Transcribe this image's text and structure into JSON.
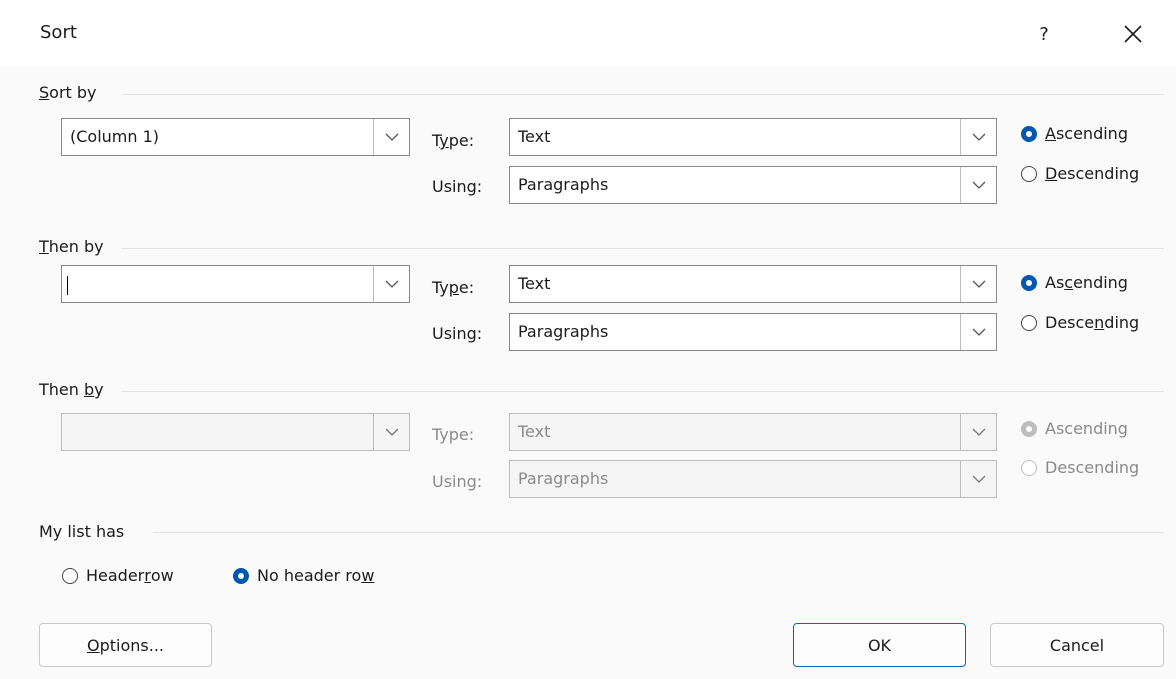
{
  "title": "Sort",
  "help_label": "?",
  "sort_by": {
    "label_u": "S",
    "label_rest": "ort by",
    "column_value": "(Column 1)",
    "type_label_a": "T",
    "type_label_u": "y",
    "type_label_b": "pe:",
    "type_value": "Text",
    "using_label": "Using:",
    "using_value": "Paragraphs",
    "asc_u": "A",
    "asc_rest": "scending",
    "desc_u": "D",
    "desc_rest": "escending"
  },
  "then_by_1": {
    "label_u": "T",
    "label_rest": "hen by",
    "column_value": "",
    "type_label_a": "Ty",
    "type_label_u": "p",
    "type_label_b": "e:",
    "type_value": "Text",
    "using_label": "Using:",
    "using_value": "Paragraphs",
    "asc_a": "As",
    "asc_u": "c",
    "asc_b": "ending",
    "desc_a": "Desce",
    "desc_u": "n",
    "desc_b": "ding"
  },
  "then_by_2": {
    "label_a": "Then ",
    "label_u": "b",
    "label_b": "y",
    "column_value": "",
    "type_label": "Type:",
    "type_value": "Text",
    "using_label": "Using:",
    "using_value": "Paragraphs",
    "asc_label": "Ascending",
    "desc_label": "Descending"
  },
  "list_header": {
    "label": "My list has",
    "header_row_a": "Header ",
    "header_row_u": "r",
    "header_row_b": "ow",
    "no_header_a": "No header ro",
    "no_header_u": "w"
  },
  "buttons": {
    "options_u": "O",
    "options_rest": "ptions...",
    "ok": "OK",
    "cancel": "Cancel"
  },
  "colors": {
    "accent": "#0058b0",
    "disabled": "#8a8a8a"
  }
}
